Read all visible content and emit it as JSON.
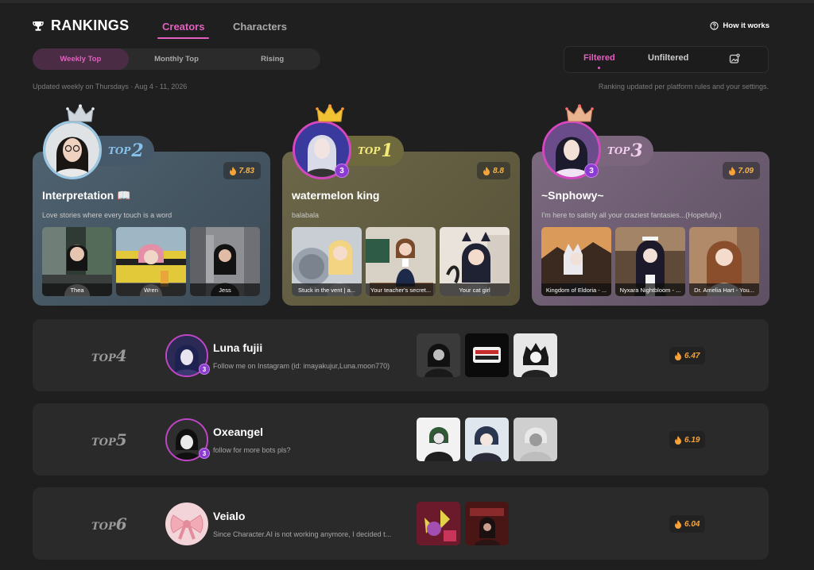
{
  "header": {
    "title": "RANKINGS",
    "tabs": [
      "Creators",
      "Characters"
    ],
    "how_it_works": "How it works"
  },
  "period_tabs": [
    "Weekly Top",
    "Monthly Top",
    "Rising"
  ],
  "filter": {
    "filtered": "Filtered",
    "unfiltered": "Unfiltered"
  },
  "updated_text": "Updated weekly on Thursdays · Aug 4 - 11, 2026",
  "rule_text": "Ranking updated per platform rules and your settings.",
  "rank_prefix": "TOP",
  "podium": [
    {
      "rank": "2",
      "name": "Interpretation 📖",
      "desc": "Love stories where every touch is a word",
      "score": "7.83",
      "chars": [
        "Thea",
        "Wren",
        "Jess"
      ]
    },
    {
      "rank": "1",
      "name": "watermelon king",
      "desc": "balabala",
      "score": "8.8",
      "chars": [
        "Stuck in the vent | a...",
        "Your teacher's secret...",
        "Your cat girl"
      ]
    },
    {
      "rank": "3",
      "name": "~Snphowy~",
      "desc": "I'm here to satisfy all your craziest fantasies...(Hopefully.)",
      "score": "7.09",
      "chars": [
        "Kingdom of Eldoria - ...",
        "Nyxara Nightbloom - ...",
        "Dr. Amelia Hart - You..."
      ]
    }
  ],
  "rows": [
    {
      "rank": "4",
      "name": "Luna fujii",
      "desc": "Follow me on Instagram (id: imayakujur,Luna.moon770)",
      "score": "6.47"
    },
    {
      "rank": "5",
      "name": "Oxeangel",
      "desc": "follow for more bots pls?",
      "score": "6.19"
    },
    {
      "rank": "6",
      "name": "Veialo",
      "desc": "Since Character.AI is not working anymore, I decided t...",
      "score": "6.04"
    }
  ],
  "colors": {
    "accent": "#e35fc0",
    "score": "#f7b34a",
    "card_top2": "#4f6270",
    "card_top1": "#6c6749",
    "card_top3": "#7c6a80"
  }
}
